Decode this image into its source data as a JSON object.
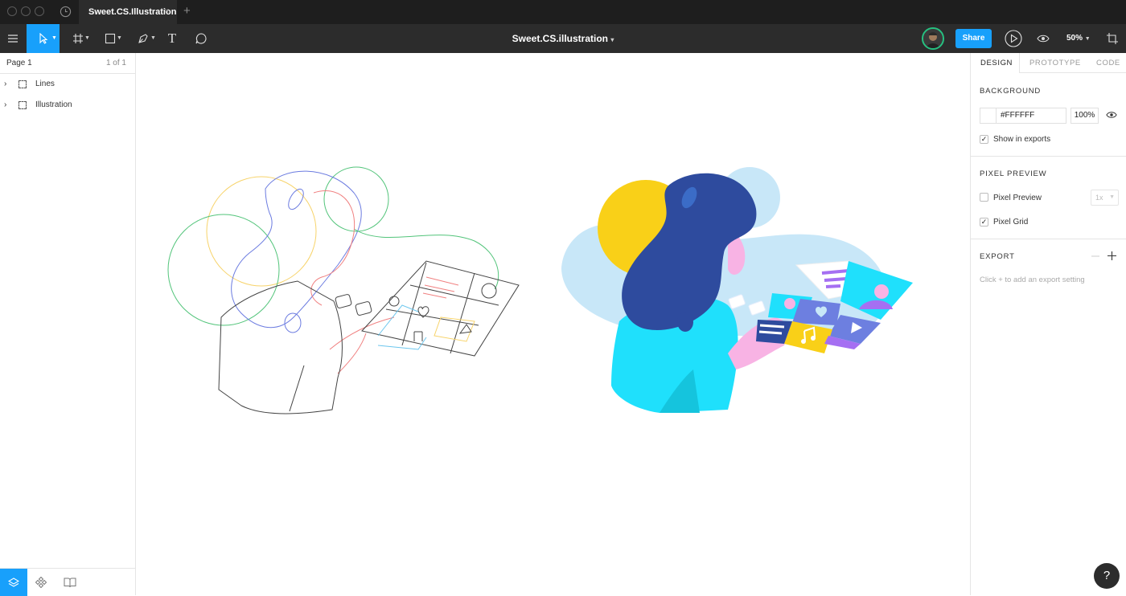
{
  "titlebar": {
    "tab_title": "Sweet.CS.Illustration",
    "tab_close": "×",
    "tab_add": "+"
  },
  "toolbar": {
    "document_title": "Sweet.CS.illustration",
    "share_label": "Share",
    "zoom_level": "50%",
    "title_caret": "▾",
    "text_tool_glyph": "T",
    "colors": {
      "accent": "#18a0fb",
      "toolbar_bg": "#2c2c2c",
      "titlebar_bg": "#1e1e1e"
    }
  },
  "left_panel": {
    "page_name": "Page 1",
    "page_count": "1 of 1",
    "layers": [
      {
        "name": "Lines"
      },
      {
        "name": "Illustration"
      }
    ]
  },
  "right_panel": {
    "tabs": [
      "DESIGN",
      "PROTOTYPE",
      "CODE"
    ],
    "background": {
      "title": "BACKGROUND",
      "hex": "#FFFFFF",
      "opacity": "100%",
      "show_in_exports_label": "Show in exports",
      "show_in_exports_checked": true
    },
    "pixel_preview": {
      "title": "PIXEL PREVIEW",
      "pixel_preview_label": "Pixel Preview",
      "pixel_preview_checked": false,
      "scale_value": "1x",
      "pixel_grid_label": "Pixel Grid",
      "pixel_grid_checked": true
    },
    "export": {
      "title": "EXPORT",
      "hint": "Click + to add an export setting"
    }
  },
  "help_label": "?"
}
